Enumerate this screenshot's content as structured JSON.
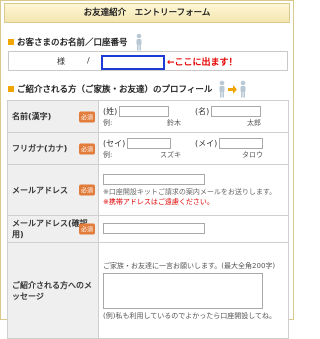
{
  "form": {
    "title": "お友達紹介　エントリーフォーム"
  },
  "section1": {
    "heading": "お客さまのお名前／口座番号",
    "sama": "様",
    "slash": "/",
    "arrow_text": "←ここに出ます！"
  },
  "section2": {
    "heading": "ご紹介される方（ご家族・お友達）のプロフィール"
  },
  "rows": {
    "name": {
      "label": "名前(漢字)",
      "required": "必須",
      "sei": "(姓)",
      "mei": "(名)",
      "ex_label": "例:",
      "ex_sei": "鈴木",
      "ex_mei": "太郎"
    },
    "furigana": {
      "label": "フリガナ(カナ)",
      "required": "必須",
      "sei": "(セイ)",
      "mei": "(メイ)",
      "ex_label": "例:",
      "ex_sei": "スズキ",
      "ex_mei": "タロウ"
    },
    "email": {
      "label": "メールアドレス",
      "required": "必須",
      "note": "※口座開設キットご請求の案内メールをお送りします。",
      "warning": "※携帯アドレスはご遠慮ください。"
    },
    "email_confirm": {
      "label": "メールアドレス(確認用)",
      "required": "必須"
    },
    "message": {
      "label": "ご紹介される方へのメッセージ",
      "guide": "ご家族・お友達に一言お願いします。(最大全角200字)",
      "example": "(例)私も利用しているのでよかったら口座開設してね。"
    }
  },
  "colors": {
    "accent": "#f0a500",
    "required_badge": "#e27c3b",
    "warning": "#e00000",
    "highlight_input": "#1f3bd6"
  },
  "icons": [
    "person-icon",
    "person-icon",
    "arrow-right-icon",
    "person-icon"
  ]
}
